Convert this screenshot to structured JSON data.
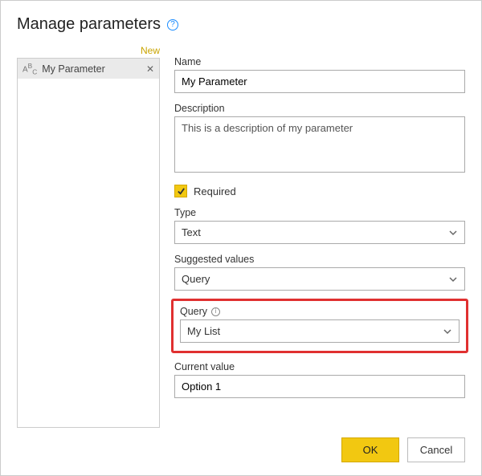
{
  "dialog": {
    "title": "Manage parameters"
  },
  "sidebar": {
    "new_label": "New",
    "items": [
      {
        "name": "My Parameter"
      }
    ]
  },
  "form": {
    "name_label": "Name",
    "name_value": "My Parameter",
    "description_label": "Description",
    "description_value": "This is a description of my parameter",
    "required_label": "Required",
    "required_checked": true,
    "type_label": "Type",
    "type_value": "Text",
    "suggested_label": "Suggested values",
    "suggested_value": "Query",
    "query_label": "Query",
    "query_value": "My List",
    "current_label": "Current value",
    "current_value": "Option 1"
  },
  "buttons": {
    "ok": "OK",
    "cancel": "Cancel"
  }
}
